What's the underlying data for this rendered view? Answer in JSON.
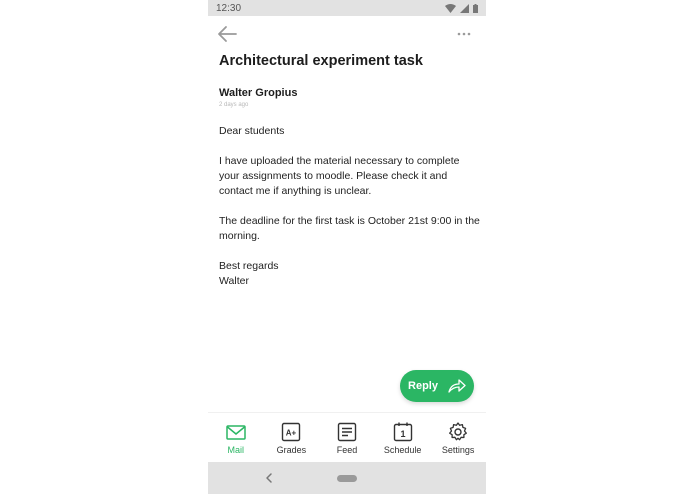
{
  "status_bar": {
    "time": "12:30"
  },
  "message": {
    "title": "Architectural experiment task",
    "sender": "Walter Gropius",
    "date": "2 days ago",
    "paragraphs": [
      "Dear students",
      "I have uploaded the material necessary to complete your assignments to moodle. Please check it and contact me if anything is unclear.",
      "The deadline for the first task is October 21st 9:00 in the morning.",
      "Best regards\nWalter"
    ]
  },
  "reply_button": {
    "label": "Reply"
  },
  "tabs": [
    {
      "label": "Mail",
      "icon": "mail-icon",
      "active": true
    },
    {
      "label": "Grades",
      "icon": "grades-icon",
      "active": false
    },
    {
      "label": "Feed",
      "icon": "feed-icon",
      "active": false
    },
    {
      "label": "Schedule",
      "icon": "schedule-icon",
      "active": false,
      "badge": "1"
    },
    {
      "label": "Settings",
      "icon": "settings-icon",
      "active": false
    }
  ],
  "colors": {
    "accent": "#2bb664",
    "status_bar": "#e2e2e2",
    "text": "#222222"
  }
}
